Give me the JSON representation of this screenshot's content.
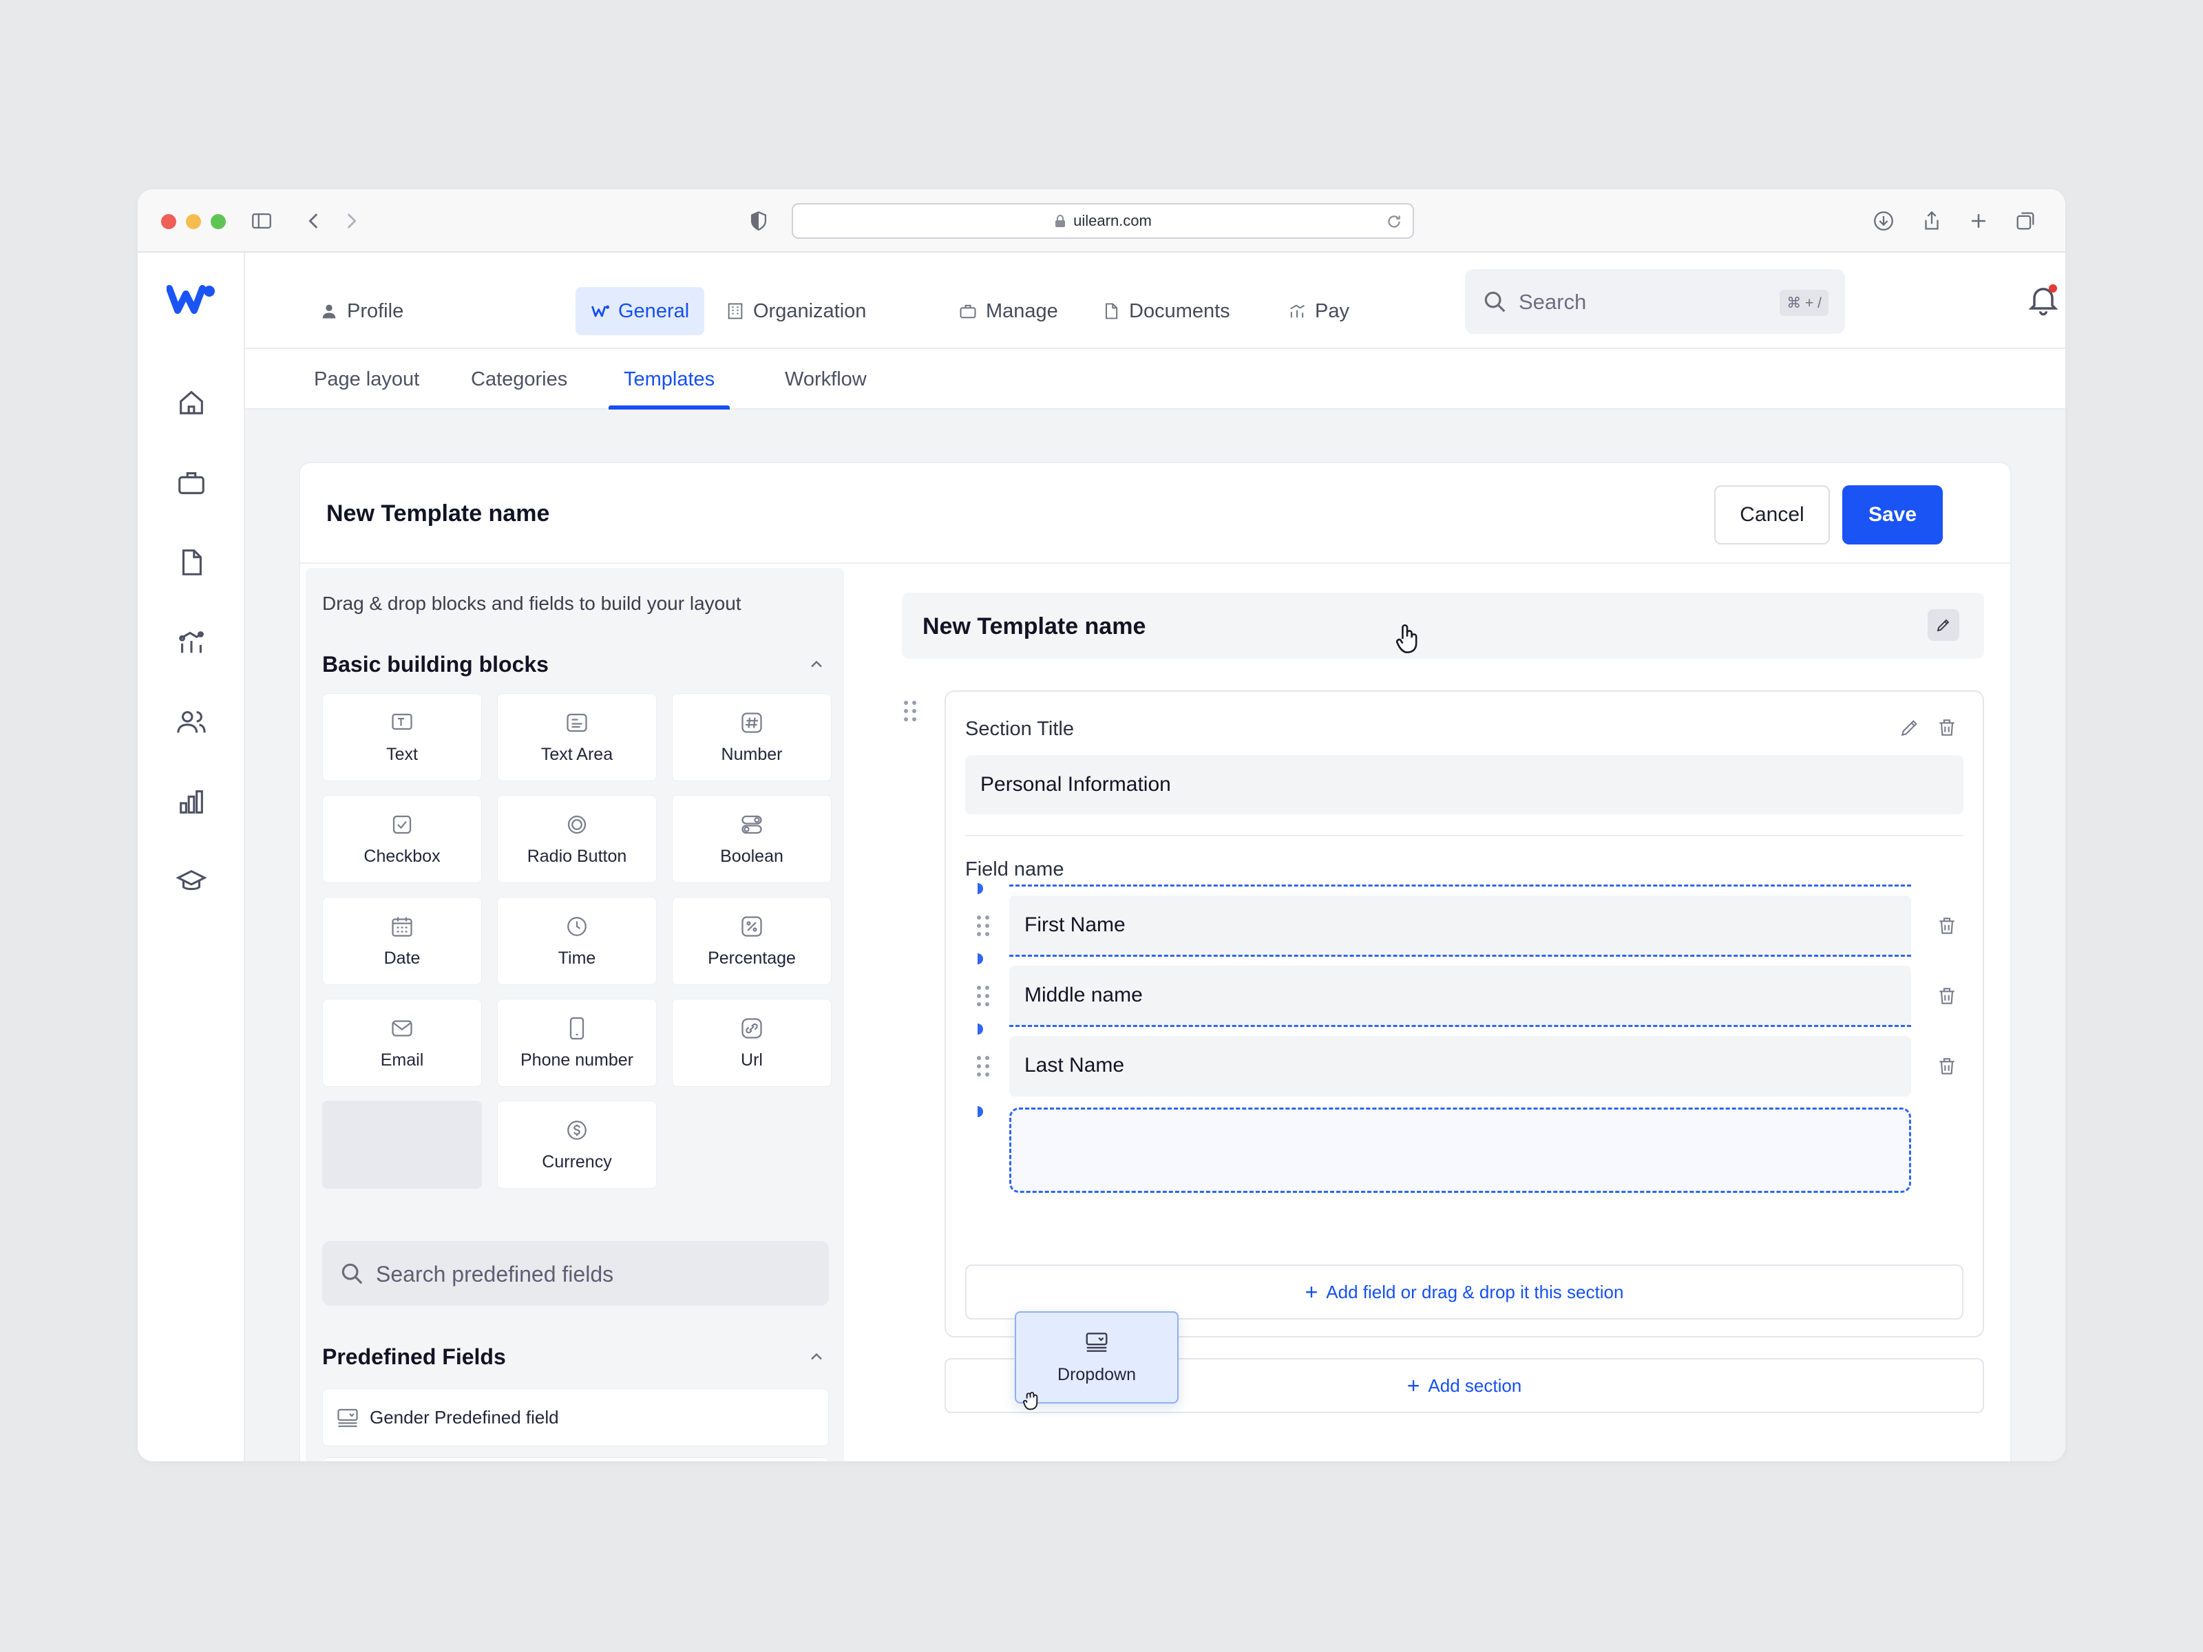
{
  "browser": {
    "url": "uilearn.com"
  },
  "topnav": {
    "items": [
      {
        "label": "Profile",
        "icon": "user-icon"
      },
      {
        "label": "General",
        "icon": "logo-w-icon",
        "active": true
      },
      {
        "label": "Organization",
        "icon": "building-icon"
      },
      {
        "label": "Manage",
        "icon": "briefcase-icon"
      },
      {
        "label": "Documents",
        "icon": "document-icon"
      },
      {
        "label": "Pay",
        "icon": "chart-icon"
      }
    ],
    "search_placeholder": "Search",
    "search_shortcut": "⌘ + /"
  },
  "subtabs": [
    {
      "label": "Page layout"
    },
    {
      "label": "Categories"
    },
    {
      "label": "Templates",
      "active": true
    },
    {
      "label": "Workflow"
    }
  ],
  "card": {
    "title": "New Template name",
    "cancel_label": "Cancel",
    "save_label": "Save"
  },
  "panel": {
    "hint": "Drag & drop blocks and fields to build your layout",
    "basic_heading": "Basic building blocks",
    "blocks": [
      {
        "label": "Text",
        "icon": "text-icon"
      },
      {
        "label": "Text Area",
        "icon": "text-area-icon"
      },
      {
        "label": "Number",
        "icon": "number-icon"
      },
      {
        "label": "Checkbox",
        "icon": "checkbox-icon"
      },
      {
        "label": "Radio Button",
        "icon": "radio-icon"
      },
      {
        "label": "Boolean",
        "icon": "toggle-icon"
      },
      {
        "label": "Date",
        "icon": "calendar-icon"
      },
      {
        "label": "Time",
        "icon": "clock-icon"
      },
      {
        "label": "Percentage",
        "icon": "percent-icon"
      },
      {
        "label": "Email",
        "icon": "mail-icon"
      },
      {
        "label": "Phone number",
        "icon": "phone-icon"
      },
      {
        "label": "Url",
        "icon": "link-icon"
      },
      {
        "label": "",
        "icon": ""
      },
      {
        "label": "Currency",
        "icon": "currency-icon"
      }
    ],
    "search_placeholder": "Search predefined fields",
    "predefined_heading": "Predefined Fields",
    "predefined": [
      {
        "label": "Gender Predefined field",
        "icon": "dropdown-icon"
      }
    ]
  },
  "editor": {
    "template_name": "New Template name",
    "section_label": "Section Title",
    "section_value": "Personal Information",
    "field_label": "Field name",
    "fields": [
      "First Name",
      "Middle name",
      "Last Name"
    ],
    "add_field_label": "Add field or drag & drop it this section",
    "add_section_label": "Add section",
    "dragging_label": "Dropdown"
  },
  "colors": {
    "accent": "#1b54f5",
    "active_bg": "#e3ecff",
    "dashed": "#2f66f0"
  }
}
